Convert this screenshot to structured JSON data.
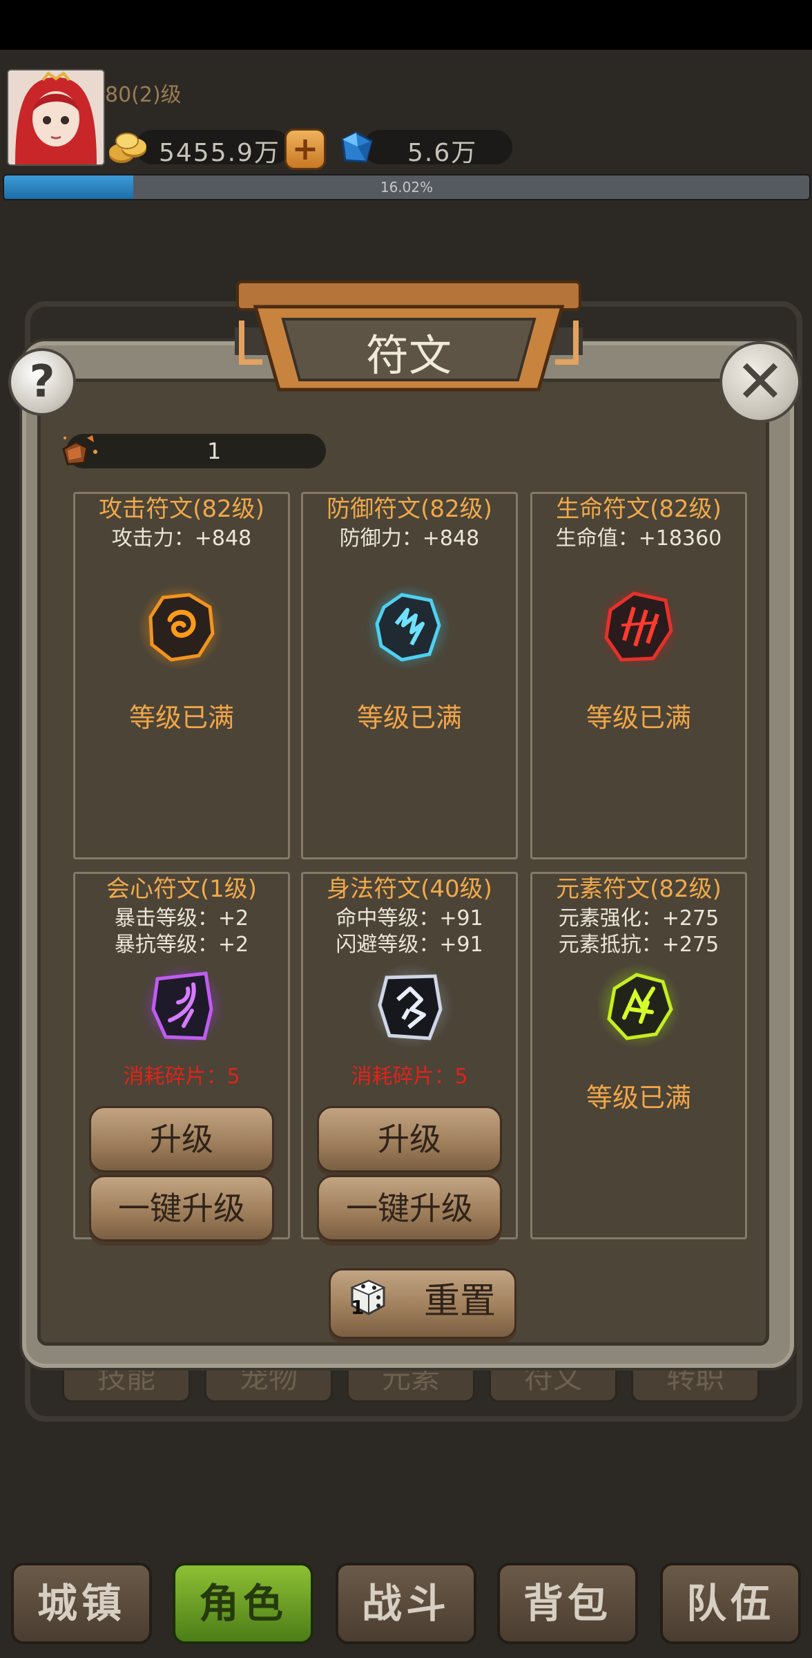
{
  "player": {
    "level_text": "80(2)级",
    "gold": "5455.9万",
    "gems": "5.6万",
    "exp_percent_text": "16.02%",
    "exp_fraction": 0.1602
  },
  "dialog": {
    "title": "符文",
    "help_label": "?",
    "close_label": "✕"
  },
  "shards": {
    "count": "1"
  },
  "runes": [
    {
      "title": "攻击符文(82级)",
      "stats": [
        "攻击力：+848"
      ],
      "status": "等级已满",
      "color": "#f08a1a"
    },
    {
      "title": "防御符文(82级)",
      "stats": [
        "防御力：+848"
      ],
      "status": "等级已满",
      "color": "#3fc9e6"
    },
    {
      "title": "生命符文(82级)",
      "stats": [
        "生命值：+18360"
      ],
      "status": "等级已满",
      "color": "#e0261e"
    },
    {
      "title": "会心符文(1级)",
      "stats": [
        "暴击等级：+2",
        "暴抗等级：+2"
      ],
      "cost": "消耗碎片：5",
      "upgrade": "升级",
      "upgrade_all": "一键升级",
      "color": "#b64ce8"
    },
    {
      "title": "身法符文(40级)",
      "stats": [
        "命中等级：+91",
        "闪避等级：+91"
      ],
      "cost": "消耗碎片：5",
      "upgrade": "升级",
      "upgrade_all": "一键升级",
      "color": "#d7dde8"
    },
    {
      "title": "元素符文(82级)",
      "stats": [
        "元素强化：+275",
        "元素抵抗：+275"
      ],
      "status": "等级已满",
      "color": "#b6e21a"
    }
  ],
  "reset": {
    "label": "重置",
    "dice_count": "1"
  },
  "bg_tabs": [
    "技能",
    "宠物",
    "元素",
    "符文",
    "转职"
  ],
  "nav": [
    {
      "label": "城镇",
      "active": false
    },
    {
      "label": "角色",
      "active": true
    },
    {
      "label": "战斗",
      "active": false
    },
    {
      "label": "背包",
      "active": false
    },
    {
      "label": "队伍",
      "active": false
    }
  ]
}
